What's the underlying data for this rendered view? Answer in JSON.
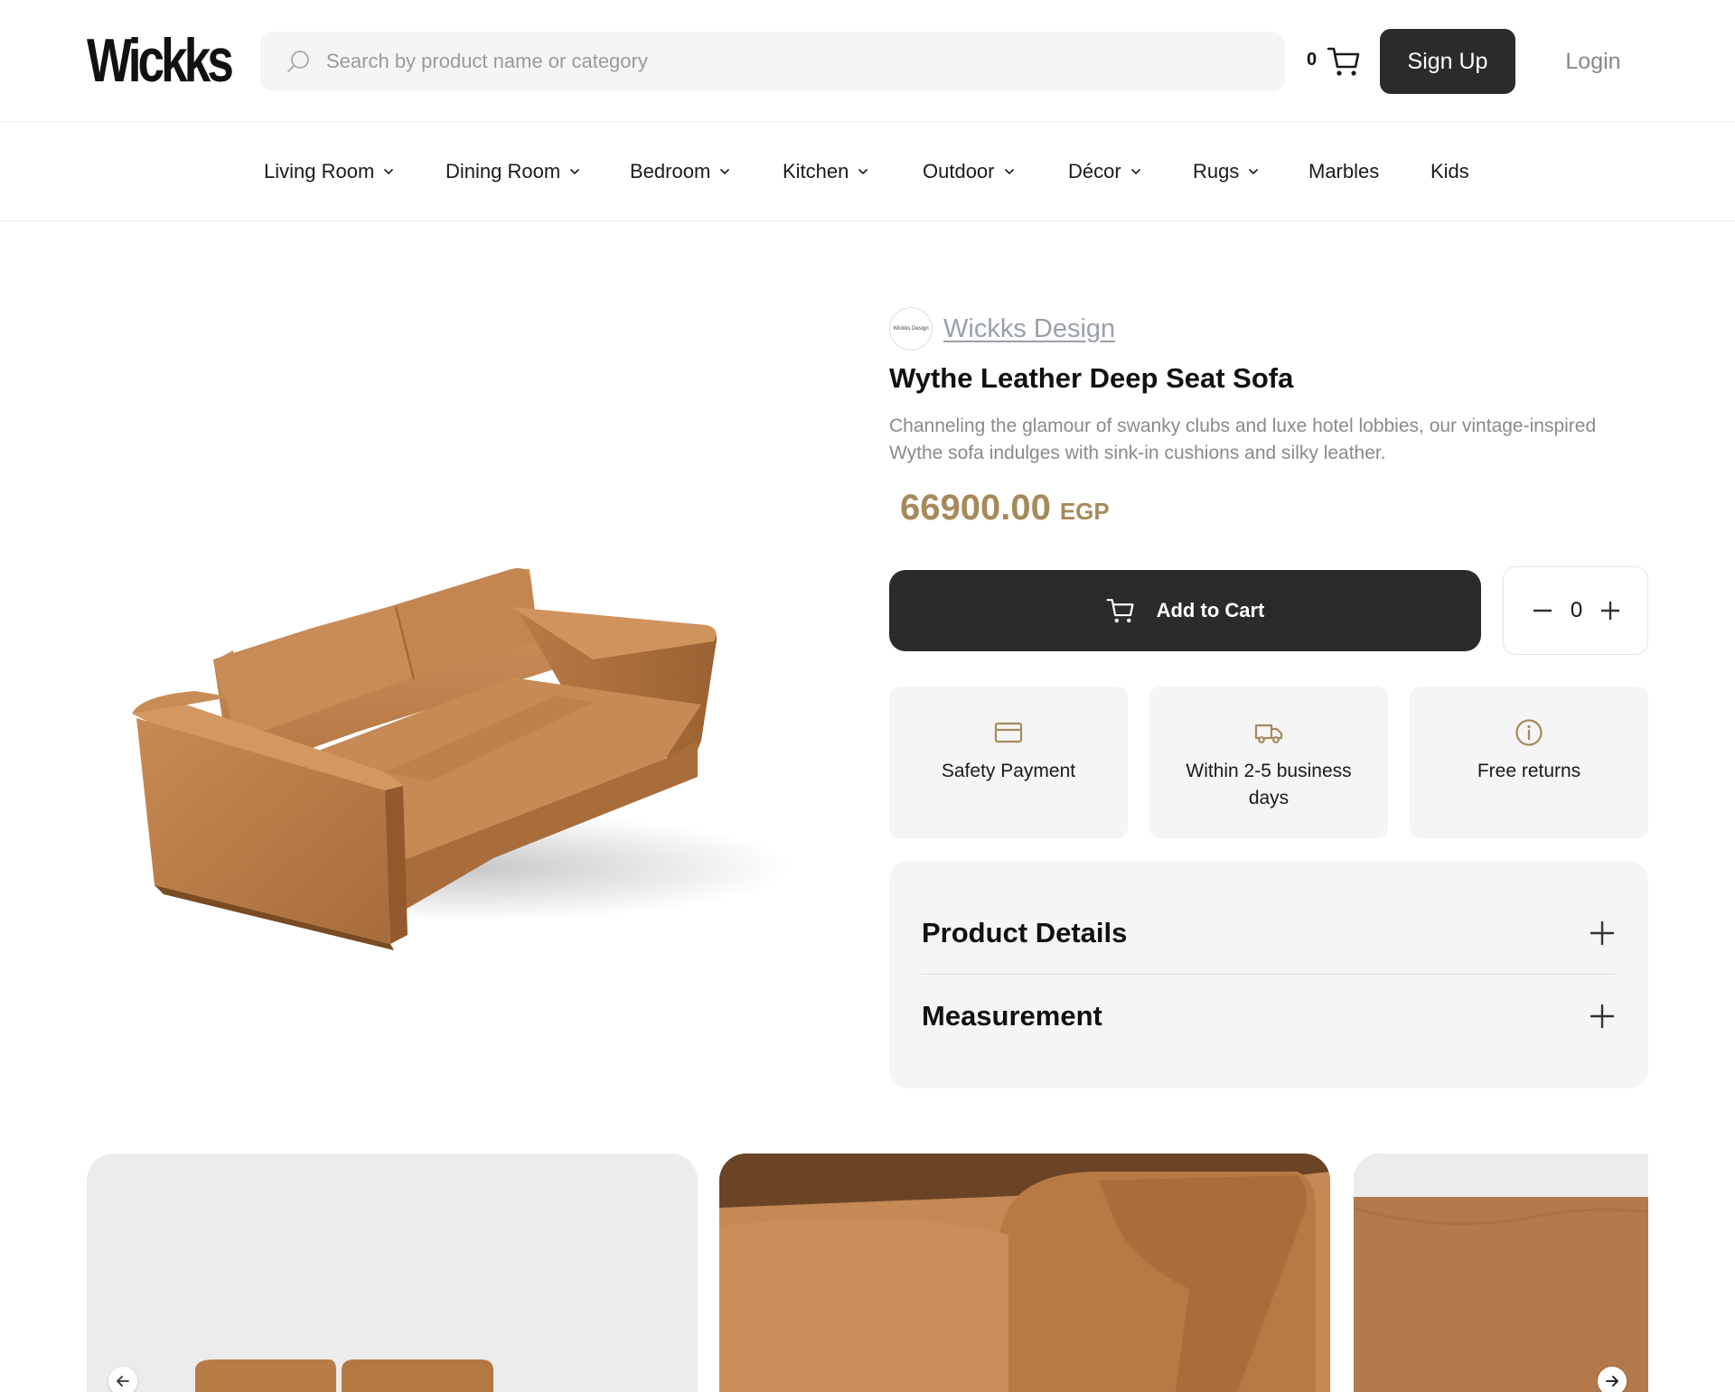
{
  "header": {
    "logo_text": "Wickks",
    "search_placeholder": "Search by product name or category",
    "cart_count": "0",
    "signup_label": "Sign Up",
    "login_label": "Login"
  },
  "nav": {
    "items": [
      {
        "label": "Living Room",
        "has_dropdown": true
      },
      {
        "label": "Dining Room",
        "has_dropdown": true
      },
      {
        "label": "Bedroom",
        "has_dropdown": true
      },
      {
        "label": "Kitchen",
        "has_dropdown": true
      },
      {
        "label": "Outdoor",
        "has_dropdown": true
      },
      {
        "label": "Décor",
        "has_dropdown": true
      },
      {
        "label": "Rugs",
        "has_dropdown": true
      },
      {
        "label": "Marbles",
        "has_dropdown": false
      },
      {
        "label": "Kids",
        "has_dropdown": false
      }
    ]
  },
  "product": {
    "brand_logo_text": "Wickks Design",
    "brand_name": "Wickks Design",
    "title": "Wythe Leather Deep Seat Sofa",
    "description": "Channeling the glamour of swanky clubs and luxe hotel lobbies, our vintage-inspired Wythe sofa indulges with sink-in cushions and silky leather.",
    "price": "66900.00",
    "currency": "EGP",
    "add_to_cart_label": "Add to Cart",
    "quantity": "0"
  },
  "features": [
    {
      "icon": "credit-card-icon",
      "label": "Safety Payment"
    },
    {
      "icon": "truck-icon",
      "label": "Within 2-5 business days"
    },
    {
      "icon": "info-icon",
      "label": "Free returns"
    }
  ],
  "accordion": [
    {
      "title": "Product Details"
    },
    {
      "title": "Measurement"
    }
  ],
  "colors": {
    "primary_dark": "#2b2b2b",
    "price_gold": "#a68a5c",
    "leather": "#b67a45",
    "panel_bg": "#f5f5f5"
  }
}
